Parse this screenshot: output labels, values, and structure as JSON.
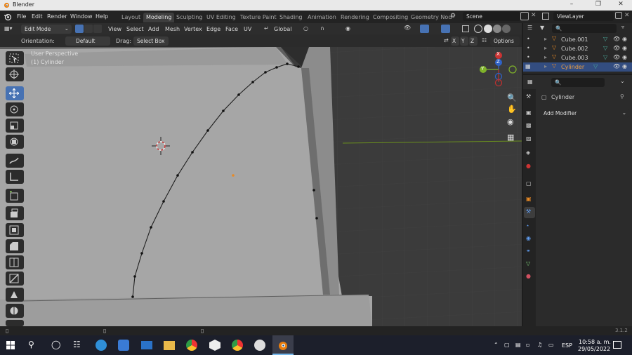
{
  "window": {
    "title": "Blender"
  },
  "menus": [
    "File",
    "Edit",
    "Render",
    "Window",
    "Help"
  ],
  "workspaces": [
    "Layout",
    "Modeling",
    "Sculpting",
    "UV Editing",
    "Texture Paint",
    "Shading",
    "Animation",
    "Rendering",
    "Compositing",
    "Geometry Nod"
  ],
  "active_workspace": "Modeling",
  "scene": "Scene",
  "view_layer": "ViewLayer",
  "header": {
    "mode": "Edit Mode",
    "menus": [
      "View",
      "Select",
      "Add",
      "Mesh",
      "Vertex",
      "Edge",
      "Face",
      "UV"
    ],
    "transform_orientation": "Global",
    "options": "Options"
  },
  "tool_settings": {
    "orientation_label": "Orientation:",
    "orientation_value": "Default",
    "drag_label": "Drag:",
    "drag_value": "Select Box"
  },
  "viewport": {
    "overlay_line1": "User Perspective",
    "overlay_line2": "(1) Cylinder",
    "axis_x": "X",
    "axis_y": "Y",
    "axis_z": "Z"
  },
  "outliner": {
    "items": [
      {
        "name": "Cube.001",
        "selected": false
      },
      {
        "name": "Cube.002",
        "selected": false
      },
      {
        "name": "Cube.003",
        "selected": false
      },
      {
        "name": "Cylinder",
        "selected": true
      }
    ]
  },
  "properties": {
    "object_name": "Cylinder",
    "add_modifier": "Add Modifier"
  },
  "status": {
    "version": "3.1.2"
  },
  "taskbar": {
    "time": "10:58 a. m.",
    "date": "29/05/2022",
    "lang": "ESP"
  },
  "colors": {
    "accent": "#4772b3",
    "selected_row": "#334d80",
    "viewport": "#3b3b3b",
    "mesh": "#a6a6a6"
  }
}
